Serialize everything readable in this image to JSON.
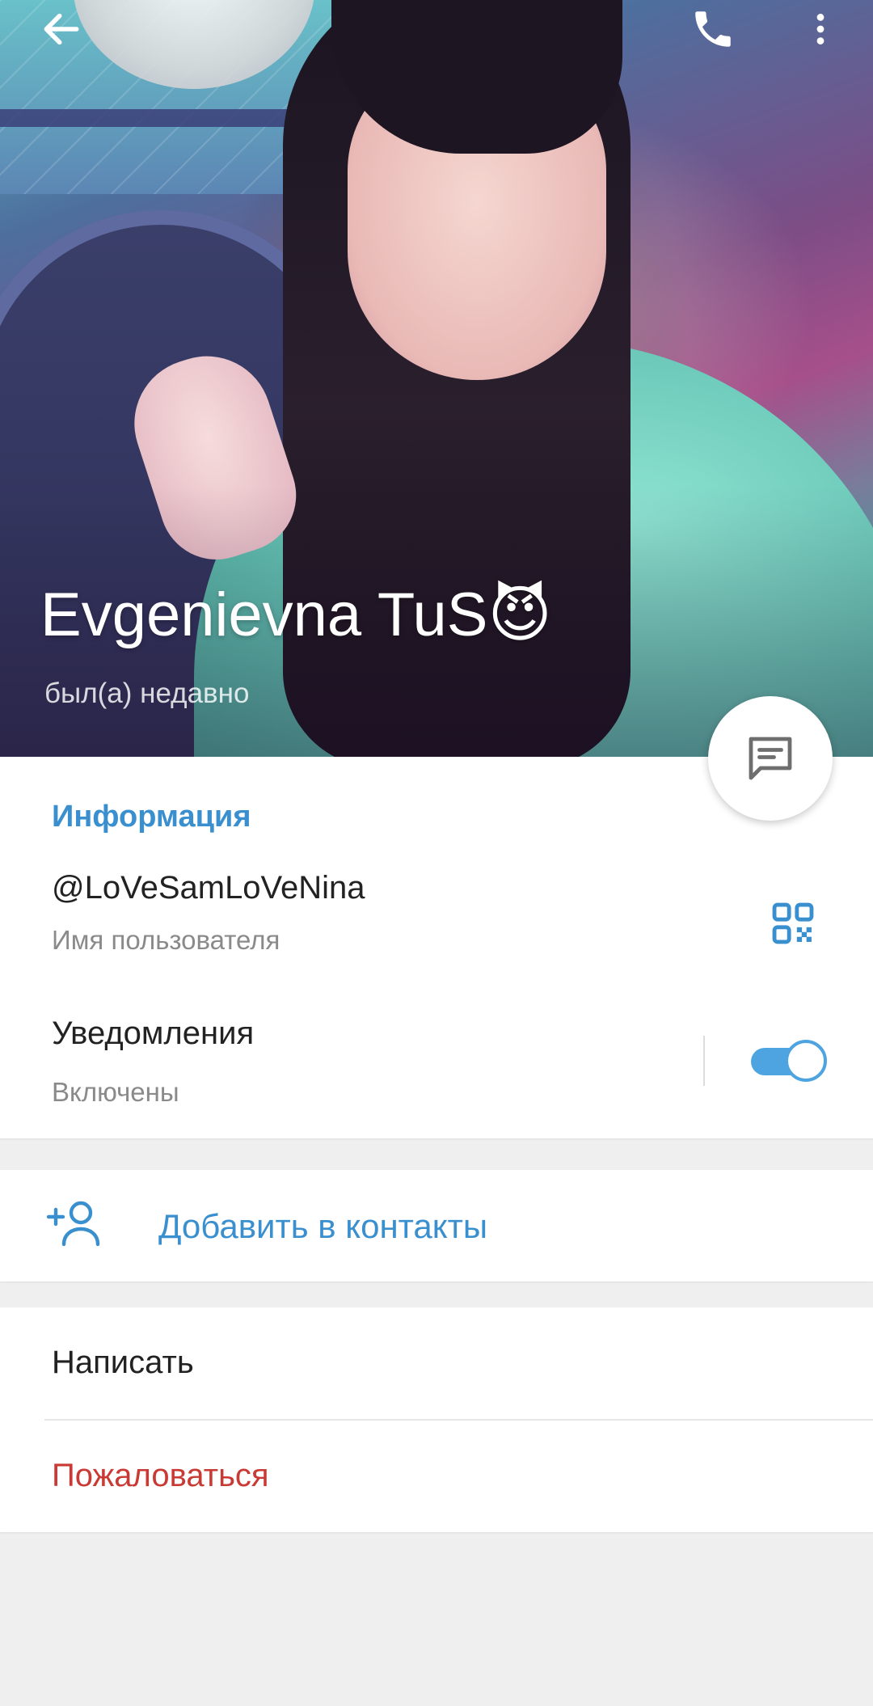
{
  "header": {
    "name": "Evgenievna TuS😈",
    "status": "был(а) недавно"
  },
  "info": {
    "section_title": "Информация",
    "username": "@LoVeSamLoVeNina",
    "username_caption": "Имя пользователя",
    "notifications_title": "Уведомления",
    "notifications_caption": "Включены",
    "notifications_enabled": true
  },
  "add_contact": {
    "label": "Добавить в контакты"
  },
  "actions": {
    "write": "Написать",
    "report": "Пожаловаться"
  },
  "icons": {
    "back": "arrow-left-icon",
    "call": "phone-icon",
    "more": "more-vertical-icon",
    "message": "message-icon",
    "qr": "qr-code-icon",
    "add_contact": "add-user-icon"
  },
  "colors": {
    "accent": "#3a8fcf",
    "toggle": "#4ea4e0",
    "danger": "#c93a35",
    "background": "#efefef"
  }
}
